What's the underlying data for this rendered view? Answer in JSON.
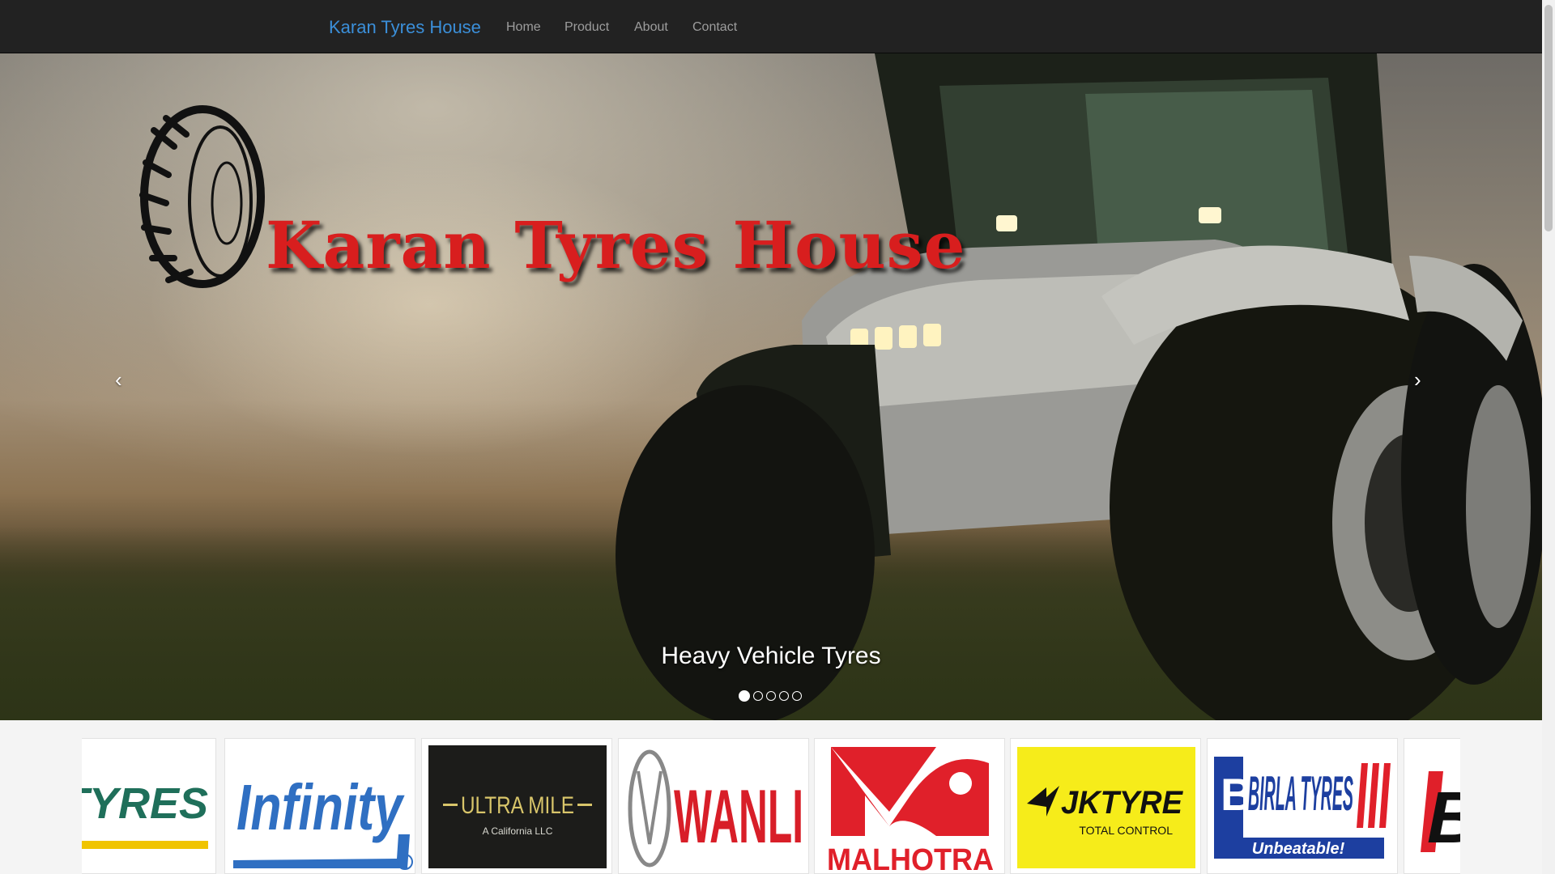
{
  "navbar": {
    "brand": "Karan Tyres House",
    "items": [
      "Home",
      "Product",
      "About",
      "Contact"
    ]
  },
  "carousel": {
    "hero_title": "Karan Tyres House",
    "caption": "Heavy Vehicle Tyres",
    "prev_symbol": "‹",
    "next_symbol": "›",
    "slide_count": 5,
    "active_slide": 1
  },
  "brands": {
    "items": [
      {
        "name": "INYU TYRES"
      },
      {
        "name": "Infinity"
      },
      {
        "name": "ULTRA MILE",
        "tagline": "A California LLC"
      },
      {
        "name": "WANLI"
      },
      {
        "name": "MALHOTRA"
      },
      {
        "name": "JKTYRE",
        "tagline": "TOTAL CONTROL"
      },
      {
        "name": "BIRLA TYRES",
        "tagline": "Unbeatable!"
      },
      {
        "name": "BI"
      }
    ]
  },
  "colors": {
    "navbar_bg": "#222222",
    "brand_blue": "#3b8fd9",
    "nav_text": "#9d9d9d",
    "hero_red": "#d81e1e"
  }
}
